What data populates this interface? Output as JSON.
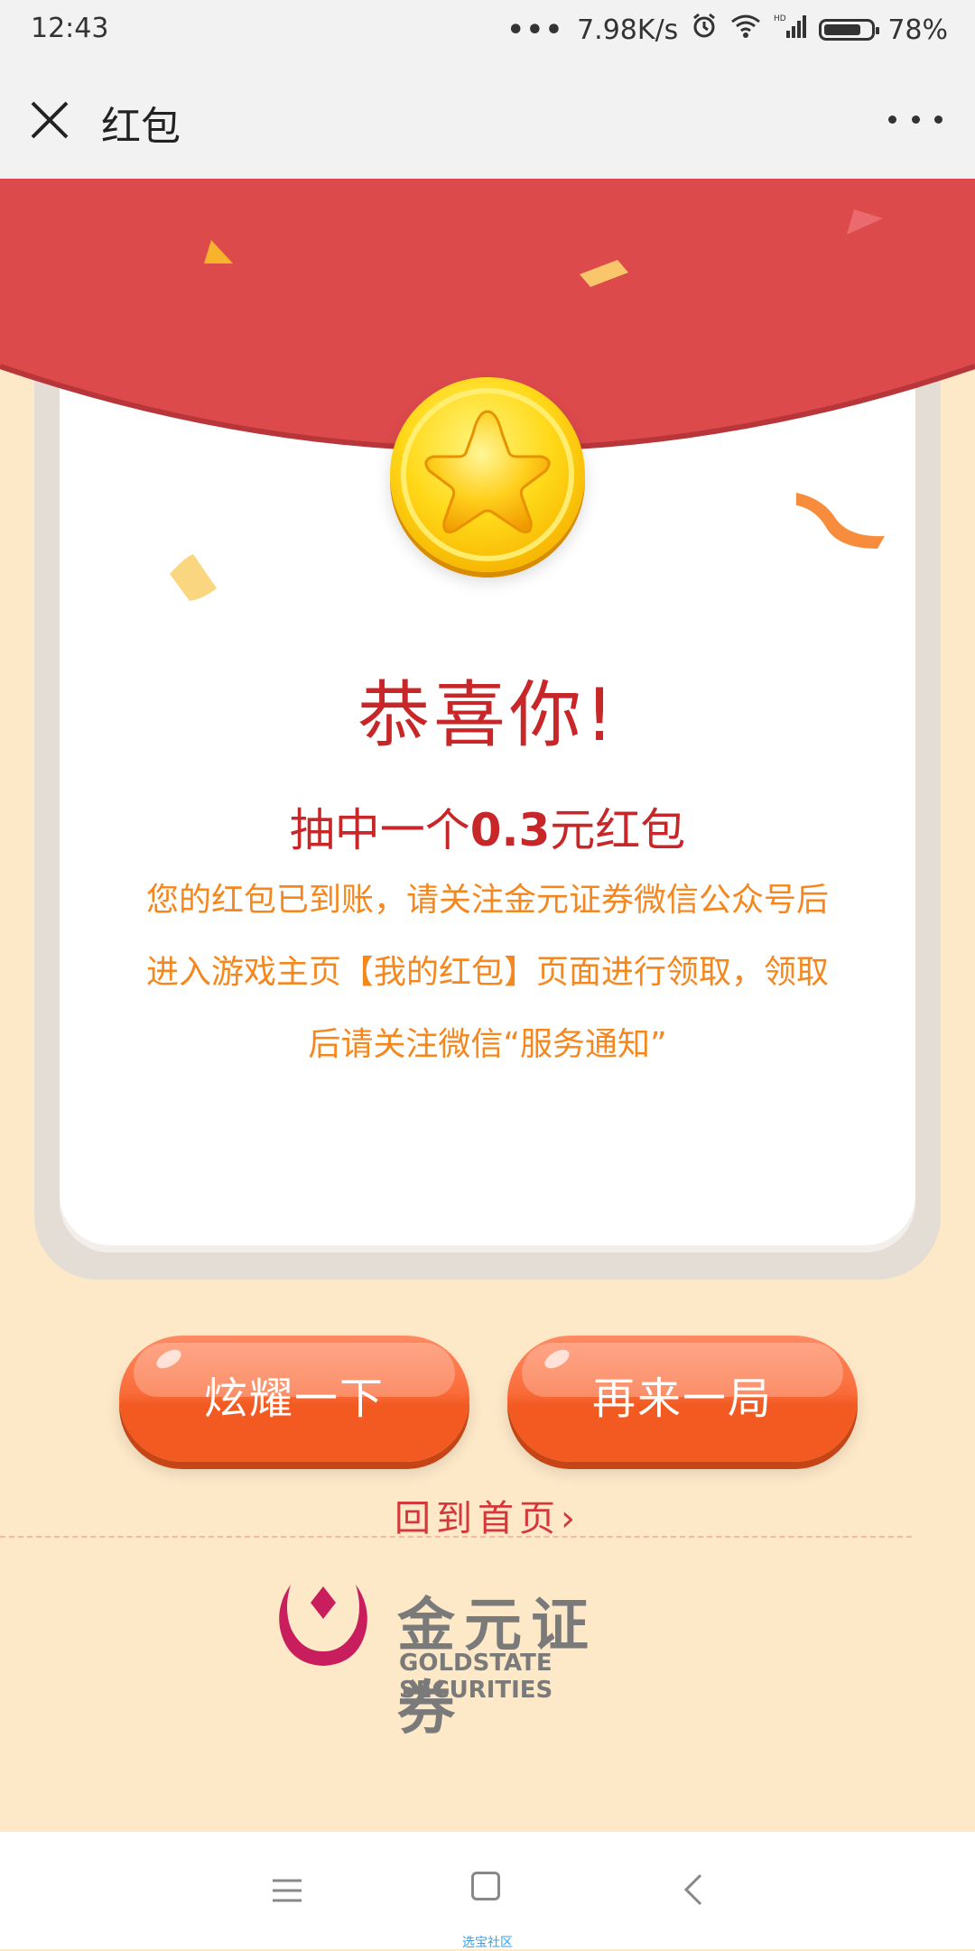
{
  "status_bar": {
    "time": "12:43",
    "network_speed": "7.98K/s",
    "battery": "78%",
    "icons": [
      "more-dots-icon",
      "alarm-icon",
      "wifi-icon",
      "hd-signal-icon",
      "battery-icon"
    ]
  },
  "title_bar": {
    "title": "红包",
    "close_icon": "close-icon",
    "more_icon": "more-dots-icon"
  },
  "card": {
    "congrats": "恭喜你!",
    "prize_prefix": "抽中一个",
    "prize_amount": "0.3",
    "prize_suffix": "元红包",
    "description_line1": "您的红包已到账，请关注金元证券微信公众号后",
    "description_line2": "进入游戏主页【我的红包】页面进行领取，领取",
    "description_line3": "后请关注微信“服务通知”",
    "coin_icon": "star-coin-icon"
  },
  "actions": {
    "show_off_label": "炫耀一下",
    "play_again_label": "再来一局",
    "home_link_label": "回到首页"
  },
  "logo": {
    "name_cn": "金元证券",
    "name_en": "GOLDSTATE SECURITIES"
  },
  "nav_bar": {
    "watermark": "选宝社区"
  },
  "colors": {
    "red": "#dc4a4c",
    "text_red": "#c8272a",
    "orange_text": "#f5871f",
    "button_orange": "#f25a22",
    "background": "#fde8c8",
    "logo_magenta": "#c81e5e"
  }
}
